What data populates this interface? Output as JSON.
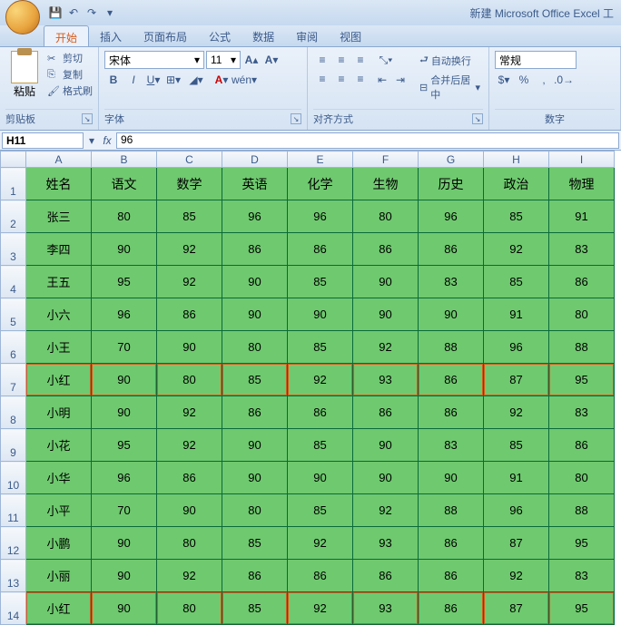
{
  "window_title": "新建 Microsoft Office Excel 工",
  "tabs": [
    "开始",
    "插入",
    "页面布局",
    "公式",
    "数据",
    "审阅",
    "视图"
  ],
  "active_tab": 0,
  "ribbon": {
    "clipboard": {
      "label": "剪贴板",
      "paste": "粘贴",
      "cut": "剪切",
      "copy": "复制",
      "format_painter": "格式刷"
    },
    "font": {
      "label": "字体",
      "name": "宋体",
      "size": "11"
    },
    "alignment": {
      "label": "对齐方式",
      "wrap": "自动换行",
      "merge": "合并后居中"
    },
    "number": {
      "label": "数字",
      "format": "常规"
    }
  },
  "name_box": "H11",
  "formula_value": "96",
  "columns": [
    "A",
    "B",
    "C",
    "D",
    "E",
    "F",
    "G",
    "H",
    "I"
  ],
  "headers": [
    "姓名",
    "语文",
    "数学",
    "英语",
    "化学",
    "生物",
    "历史",
    "政治",
    "物理"
  ],
  "rows": [
    {
      "n": 2,
      "hl": false,
      "cells": [
        "张三",
        "80",
        "85",
        "96",
        "96",
        "80",
        "96",
        "85",
        "91"
      ]
    },
    {
      "n": 3,
      "hl": false,
      "cells": [
        "李四",
        "90",
        "92",
        "86",
        "86",
        "86",
        "86",
        "92",
        "83"
      ]
    },
    {
      "n": 4,
      "hl": false,
      "cells": [
        "王五",
        "95",
        "92",
        "90",
        "85",
        "90",
        "83",
        "85",
        "86"
      ]
    },
    {
      "n": 5,
      "hl": false,
      "cells": [
        "小六",
        "96",
        "86",
        "90",
        "90",
        "90",
        "90",
        "91",
        "80"
      ]
    },
    {
      "n": 6,
      "hl": false,
      "cells": [
        "小王",
        "70",
        "90",
        "80",
        "85",
        "92",
        "88",
        "96",
        "88"
      ]
    },
    {
      "n": 7,
      "hl": true,
      "cells": [
        "小红",
        "90",
        "80",
        "85",
        "92",
        "93",
        "86",
        "87",
        "95"
      ]
    },
    {
      "n": 8,
      "hl": false,
      "cells": [
        "小明",
        "90",
        "92",
        "86",
        "86",
        "86",
        "86",
        "92",
        "83"
      ]
    },
    {
      "n": 9,
      "hl": false,
      "cells": [
        "小花",
        "95",
        "92",
        "90",
        "85",
        "90",
        "83",
        "85",
        "86"
      ]
    },
    {
      "n": 10,
      "hl": false,
      "cells": [
        "小华",
        "96",
        "86",
        "90",
        "90",
        "90",
        "90",
        "91",
        "80"
      ]
    },
    {
      "n": 11,
      "hl": false,
      "cells": [
        "小平",
        "70",
        "90",
        "80",
        "85",
        "92",
        "88",
        "96",
        "88"
      ]
    },
    {
      "n": 12,
      "hl": false,
      "cells": [
        "小鹏",
        "90",
        "80",
        "85",
        "92",
        "93",
        "86",
        "87",
        "95"
      ]
    },
    {
      "n": 13,
      "hl": false,
      "cells": [
        "小丽",
        "90",
        "92",
        "86",
        "86",
        "86",
        "86",
        "92",
        "83"
      ]
    },
    {
      "n": 14,
      "hl": true,
      "cells": [
        "小红",
        "90",
        "80",
        "85",
        "92",
        "93",
        "86",
        "87",
        "95"
      ]
    }
  ]
}
